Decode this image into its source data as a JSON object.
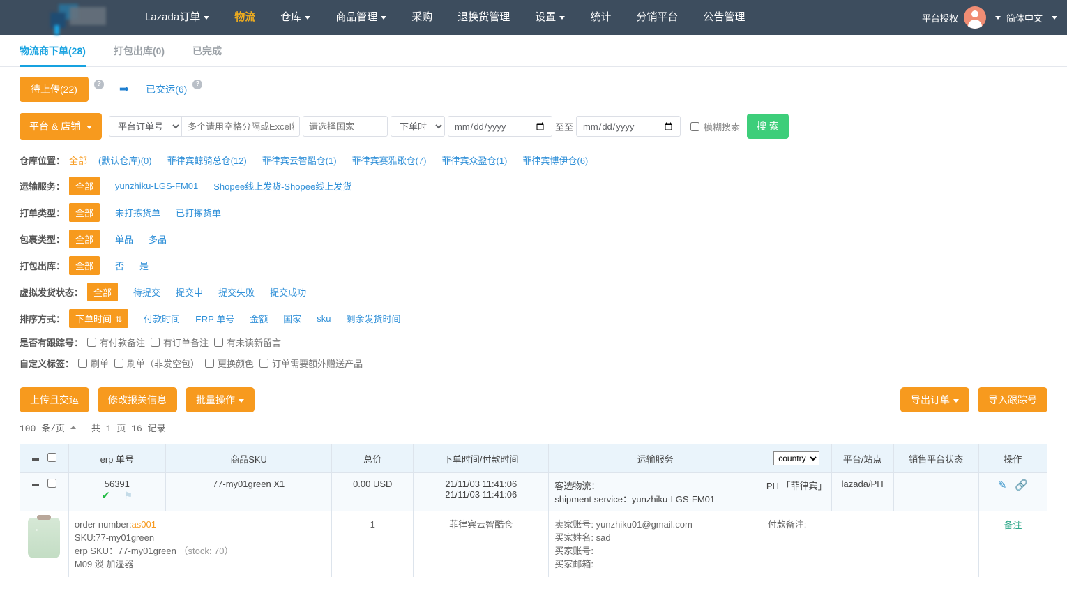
{
  "topnav": {
    "items": [
      {
        "label": "Lazada订单",
        "dropdown": true,
        "active": false
      },
      {
        "label": "物流",
        "dropdown": false,
        "active": true
      },
      {
        "label": "仓库",
        "dropdown": true,
        "active": false
      },
      {
        "label": "商品管理",
        "dropdown": true,
        "active": false
      },
      {
        "label": "采购",
        "dropdown": false,
        "active": false
      },
      {
        "label": "退换货管理",
        "dropdown": false,
        "active": false
      },
      {
        "label": "设置",
        "dropdown": true,
        "active": false
      },
      {
        "label": "统计",
        "dropdown": false,
        "active": false
      },
      {
        "label": "分销平台",
        "dropdown": false,
        "active": false
      },
      {
        "label": "公告管理",
        "dropdown": false,
        "active": false
      }
    ],
    "platform_auth": "平台授权",
    "language": "简体中文"
  },
  "tabs": [
    {
      "label": "物流商下单(28)",
      "active": true
    },
    {
      "label": "打包出库(0)",
      "active": false
    },
    {
      "label": "已完成",
      "active": false
    }
  ],
  "status_flow": {
    "pending_upload": "待上传(22)",
    "arrow": "➡",
    "shipped": "已交运(6)",
    "help": "?"
  },
  "search": {
    "platform_shop_button": "平台 & 店铺",
    "order_no_select": "平台订单号",
    "order_no_placeholder": "多个请用空格分隔或Excel粘贴",
    "country_placeholder": "请选择国家",
    "time_select": "下单时间",
    "date_from": "",
    "date_to": "",
    "date_format_hint": "年 /月/日",
    "between_label": "至至",
    "fuzzy_label": "模糊搜索",
    "fuzzy_checked": false,
    "search_button": "搜 索"
  },
  "filters": [
    {
      "label": "仓库位置：",
      "style": "plain",
      "options": [
        {
          "text": "全部",
          "active": true
        },
        {
          "text": "(默认仓库)(0)",
          "active": false
        },
        {
          "text": "菲律宾鲸骑总仓(12)",
          "active": false
        },
        {
          "text": "菲律宾云智酷仓(1)",
          "active": false
        },
        {
          "text": "菲律宾赛雅歌仓(7)",
          "active": false
        },
        {
          "text": "菲律宾众盈仓(1)",
          "active": false
        },
        {
          "text": "菲律宾博伊仓(6)",
          "active": false
        }
      ]
    },
    {
      "label": "运输服务：",
      "style": "boxed",
      "options": [
        {
          "text": "全部",
          "active": true
        },
        {
          "text": "yunzhiku-LGS-FM01",
          "active": false
        },
        {
          "text": "Shopee线上发货-Shopee线上发货",
          "active": false
        }
      ]
    },
    {
      "label": "打单类型：",
      "style": "boxed",
      "options": [
        {
          "text": "全部",
          "active": true
        },
        {
          "text": "未打拣货单",
          "active": false
        },
        {
          "text": "已打拣货单",
          "active": false
        }
      ]
    },
    {
      "label": "包裹类型：",
      "style": "boxed",
      "options": [
        {
          "text": "全部",
          "active": true
        },
        {
          "text": "单品",
          "active": false
        },
        {
          "text": "多品",
          "active": false
        }
      ]
    },
    {
      "label": "打包出库：",
      "style": "boxed",
      "options": [
        {
          "text": "全部",
          "active": true
        },
        {
          "text": "否",
          "active": false
        },
        {
          "text": "是",
          "active": false
        }
      ]
    },
    {
      "label": "虚拟发货状态：",
      "style": "boxed",
      "options": [
        {
          "text": "全部",
          "active": true
        },
        {
          "text": "待提交",
          "active": false
        },
        {
          "text": "提交中",
          "active": false
        },
        {
          "text": "提交失败",
          "active": false
        },
        {
          "text": "提交成功",
          "active": false
        }
      ]
    },
    {
      "label": "排序方式：",
      "style": "boxed",
      "sort_icon": "⇅",
      "options": [
        {
          "text": "下单时间",
          "active": true
        },
        {
          "text": "付款时间",
          "active": false
        },
        {
          "text": "ERP 单号",
          "active": false
        },
        {
          "text": "金额",
          "active": false
        },
        {
          "text": "国家",
          "active": false
        },
        {
          "text": "sku",
          "active": false
        },
        {
          "text": "剩余发货时间",
          "active": false
        }
      ]
    }
  ],
  "checkbox_rows": [
    {
      "label": "是否有跟踪号：",
      "items": [
        {
          "text": "有付款备注",
          "checked": false
        },
        {
          "text": "有订单备注",
          "checked": false
        },
        {
          "text": "有未读新留言",
          "checked": false
        }
      ]
    },
    {
      "label": "自定义标签：",
      "items": [
        {
          "text": "刷单",
          "checked": false
        },
        {
          "text": "刷单（非发空包）",
          "checked": false
        },
        {
          "text": "更换颜色",
          "checked": false
        },
        {
          "text": "订单需要额外赠送产品",
          "checked": false
        }
      ]
    }
  ],
  "actionbar": {
    "left": [
      {
        "label": "上传且交运",
        "dropdown": false
      },
      {
        "label": "修改报关信息",
        "dropdown": false
      },
      {
        "label": "批量操作",
        "dropdown": true
      }
    ],
    "right": [
      {
        "label": "导出订单",
        "dropdown": true
      },
      {
        "label": "导入跟踪号",
        "dropdown": false
      }
    ]
  },
  "pager": {
    "page_size": "100 条/页",
    "total_text": "共 1 页 16 记录"
  },
  "table": {
    "headers": [
      "",
      "erp 单号",
      "商品SKU",
      "总价",
      "下单时间/付款时间",
      "运输服务",
      "country",
      "平台/站点",
      "销售平台状态",
      "操作"
    ],
    "country_select_value": "country",
    "summary_row": {
      "erp_no": "56391",
      "check_mark": "✔",
      "flag_mark": "⚑",
      "sku": "77-my01green X1",
      "total_price": "0.00 USD",
      "order_time": "21/11/03 11:41:06",
      "pay_time": "21/11/03 11:41:06",
      "shipping_line1": "客选物流：",
      "shipping_line2": "shipment service：yunzhiku-LGS-FM01",
      "country": "PH 「菲律宾」",
      "platform_site": "lazada/PH",
      "platform_status": "",
      "op_edit_icon": "✎",
      "op_attach_icon": "🔗"
    },
    "detail_row": {
      "order_number_label": "order number:",
      "order_number_value": "as001",
      "sku_line": "SKU:77-my01green",
      "erp_sku_line": "erp SKU：77-my01green",
      "stock_line": "（stock: 70）",
      "product_name": "M09 淡 加湿器",
      "qty": "1",
      "warehouse": "菲律宾云智酷仓",
      "seller_account": "卖家账号: yunzhiku01@gmail.com",
      "buyer_name": "买家姓名: sad",
      "buyer_account": "买家账号:",
      "buyer_email": "买家邮箱:",
      "pay_note": "付款备注:",
      "note_button": "备注"
    }
  },
  "colors": {
    "nav_bg": "#3d4d5e",
    "accent_orange": "#f79a1e",
    "accent_blue": "#3090d8",
    "search_green": "#3dce7a",
    "tab_active": "#17a2e0"
  }
}
